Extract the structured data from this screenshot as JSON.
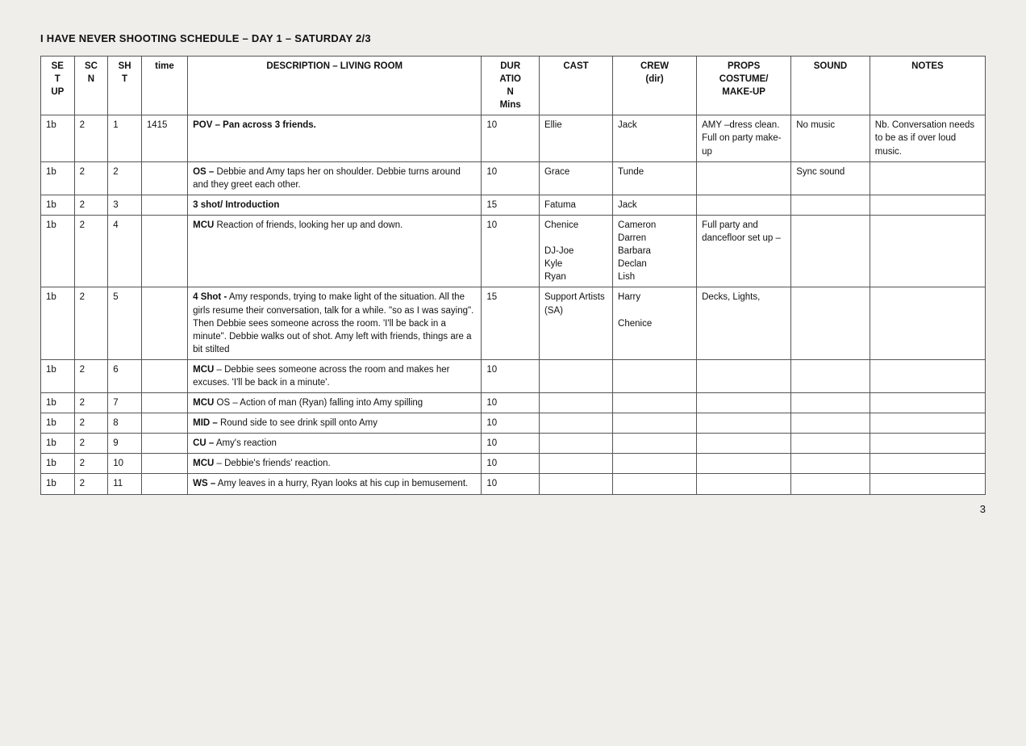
{
  "title": "I HAVE NEVER SHOOTING SCHEDULE – DAY 1 – SATURDAY 2/3",
  "page_number": "3",
  "headers": {
    "set": "SE\nT\nUP",
    "sc": "SC\nN",
    "sh": "SH\nT",
    "time": "time",
    "desc": "DESCRIPTION – LIVING ROOM",
    "dur": "DUR\nATIO\nN\nMins",
    "cast": "CAST",
    "crew": "CREW\n(dir)",
    "props": "PROPS\nCOSTUME/\nMAKE-UP",
    "sound": "SOUND",
    "notes": "NOTES"
  },
  "rows": [
    {
      "set": "1b",
      "sc": "2",
      "sh": "1",
      "time": "1415",
      "desc": "POV – Pan across 3 friends.",
      "desc_bold": true,
      "dur": "10",
      "cast": "Ellie",
      "crew": "Jack",
      "props": "AMY –dress clean. Full on party make-up",
      "sound": "No music",
      "notes": "Nb. Conversation needs to be as if over loud music."
    },
    {
      "set": "1b",
      "sc": "2",
      "sh": "2",
      "time": "",
      "desc": "OS – Debbie and Amy taps her on shoulder. Debbie turns around and they greet each other.",
      "desc_bold": false,
      "dur": "10",
      "cast": "Grace",
      "crew": "Tunde",
      "props": "",
      "sound": "Sync sound",
      "notes": ""
    },
    {
      "set": "1b",
      "sc": "2",
      "sh": "3",
      "time": "",
      "desc": "3 shot/ Introduction",
      "desc_bold": true,
      "dur": "15",
      "cast": "Fatuma",
      "crew": "Jack",
      "props": "",
      "sound": "",
      "notes": ""
    },
    {
      "set": "1b",
      "sc": "2",
      "sh": "4",
      "time": "",
      "desc": "MCU Reaction of friends, looking her up and down.",
      "desc_bold": false,
      "dur": "10",
      "cast": "Chenice\n\nDJ-Joe\nKyle\nRyan",
      "crew": "Cameron\nDarren\nBarbara\nDeclan\nLish",
      "props": "Full party and dancefloor set up –",
      "sound": "",
      "notes": ""
    },
    {
      "set": "1b",
      "sc": "2",
      "sh": "5",
      "time": "",
      "desc": "4 Shot - Amy responds, trying to make light of the situation. All the girls resume their conversation, talk for a while. \"so as I was saying\". Then Debbie sees someone across the room. 'I'll be back in a minute\". Debbie walks out of shot.  Amy left with friends, things are a bit stilted",
      "desc_bold": false,
      "dur": "15",
      "cast": "Support Artists (SA)",
      "crew": "Harry\n\nChenice",
      "props": "Decks, Lights,",
      "sound": "",
      "notes": ""
    },
    {
      "set": "1b",
      "sc": "2",
      "sh": "6",
      "time": "",
      "desc": "MCU – Debbie sees someone across the room and makes her excuses. 'I'll be back in a minute'.",
      "desc_bold": false,
      "dur": "10",
      "cast": "",
      "crew": "",
      "props": "",
      "sound": "",
      "notes": ""
    },
    {
      "set": "1b",
      "sc": "2",
      "sh": "7",
      "time": "",
      "desc": "MCU OS – Action of man (Ryan) falling into Amy spilling",
      "desc_bold": false,
      "dur": "10",
      "cast": "",
      "crew": "",
      "props": "",
      "sound": "",
      "notes": ""
    },
    {
      "set": "1b",
      "sc": "2",
      "sh": "8",
      "time": "",
      "desc": "MID – Round side to see drink spill onto Amy",
      "desc_bold": false,
      "dur": "10",
      "cast": "",
      "crew": "",
      "props": "",
      "sound": "",
      "notes": ""
    },
    {
      "set": "1b",
      "sc": "2",
      "sh": "9",
      "time": "",
      "desc": "CU – Amy's reaction",
      "desc_bold": false,
      "dur": "10",
      "cast": "",
      "crew": "",
      "props": "",
      "sound": "",
      "notes": ""
    },
    {
      "set": "1b",
      "sc": "2",
      "sh": "10",
      "time": "",
      "desc": "MCU – Debbie's friends' reaction.",
      "desc_bold": false,
      "dur": "10",
      "cast": "",
      "crew": "",
      "props": "",
      "sound": "",
      "notes": ""
    },
    {
      "set": "1b",
      "sc": "2",
      "sh": "11",
      "time": "",
      "desc": "WS – Amy leaves in a hurry, Ryan looks at his cup in bemusement.",
      "desc_bold": false,
      "dur": "10",
      "cast": "",
      "crew": "",
      "props": "",
      "sound": "",
      "notes": ""
    }
  ]
}
